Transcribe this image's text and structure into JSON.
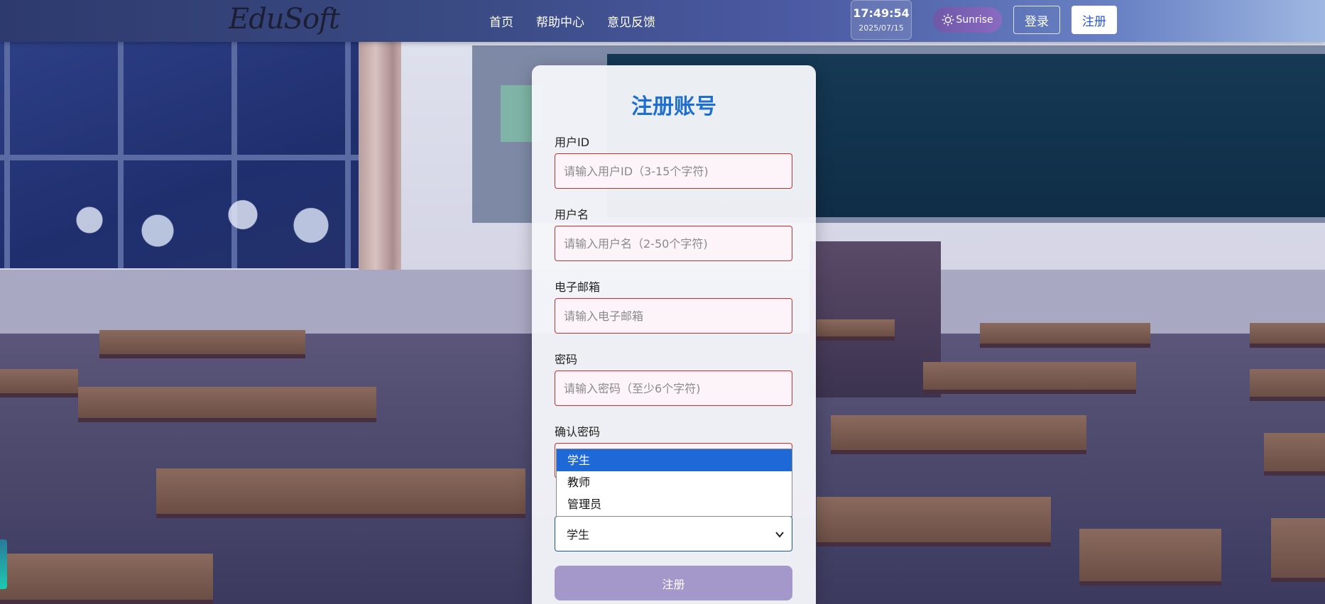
{
  "brand": {
    "logo_text": "EduSoft"
  },
  "nav": {
    "links": [
      "首页",
      "帮助中心",
      "意见反馈"
    ]
  },
  "clock": {
    "time": "17:49:54",
    "date": "2025/07/15"
  },
  "theme": {
    "label": "Sunrise",
    "icon": "sun-icon"
  },
  "auth": {
    "login_label": "登录",
    "register_label": "注册"
  },
  "form": {
    "title": "注册账号",
    "fields": {
      "user_id": {
        "label": "用户ID",
        "placeholder": "请输入用户ID（3-15个字符)",
        "value": ""
      },
      "username": {
        "label": "用户名",
        "placeholder": "请输入用户名（2-50个字符)",
        "value": ""
      },
      "email": {
        "label": "电子邮箱",
        "placeholder": "请输入电子邮箱",
        "value": ""
      },
      "password": {
        "label": "密码",
        "placeholder": "请输入密码（至少6个字符)",
        "value": ""
      },
      "confirm_password": {
        "label": "确认密码",
        "placeholder": "",
        "value": ""
      }
    },
    "role": {
      "selected": "学生",
      "options": [
        "学生",
        "教师",
        "管理员"
      ],
      "highlighted_index": 0
    },
    "submit_label": "注册"
  },
  "colors": {
    "title": "#1f6fd1",
    "input_border_error": "#c9302c",
    "submit_bg": "#a497c9",
    "dropdown_highlight": "#1f68d8"
  }
}
